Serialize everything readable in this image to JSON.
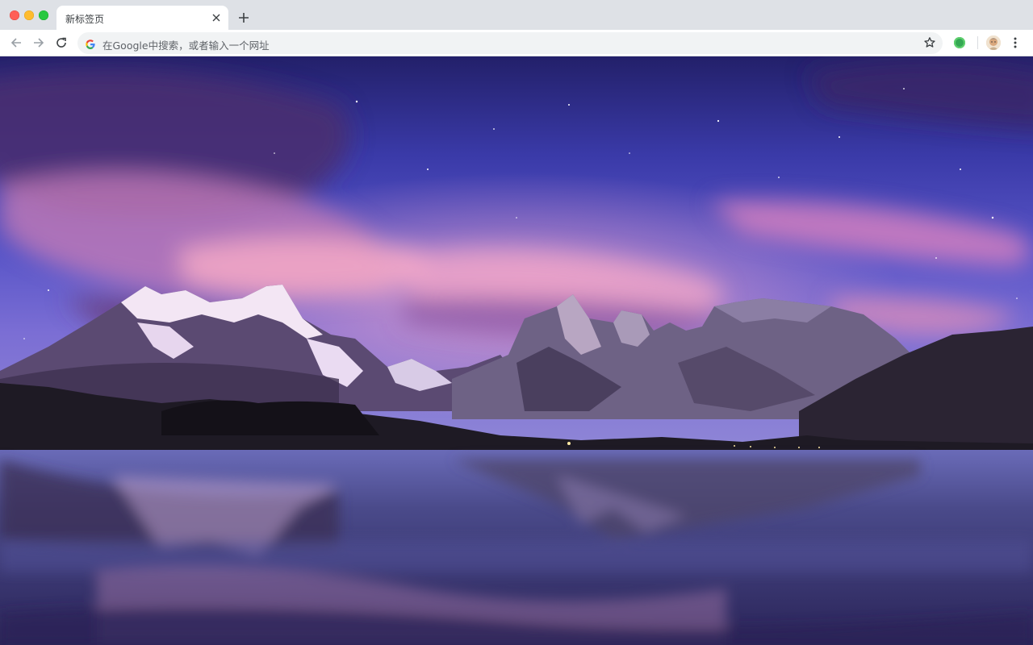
{
  "tab": {
    "title": "新标签页",
    "favicon": "none"
  },
  "omnibox": {
    "placeholder": "在Google中搜索，或者输入一个网址"
  },
  "icons": {
    "close": "close-icon",
    "new_tab": "plus-icon",
    "back": "arrow-left-icon",
    "forward": "arrow-right-icon",
    "reload": "reload-icon",
    "search_provider": "google-g-icon",
    "bookmark": "star-icon",
    "extension": "green-circle-icon",
    "menu": "kebab-menu-icon"
  },
  "colors": {
    "tabstrip_bg": "#dee1e6",
    "toolbar_bg": "#ffffff",
    "omnibox_bg": "#f1f3f4"
  },
  "wallpaper": {
    "description_tag": "mountain-lake-night-sky"
  }
}
